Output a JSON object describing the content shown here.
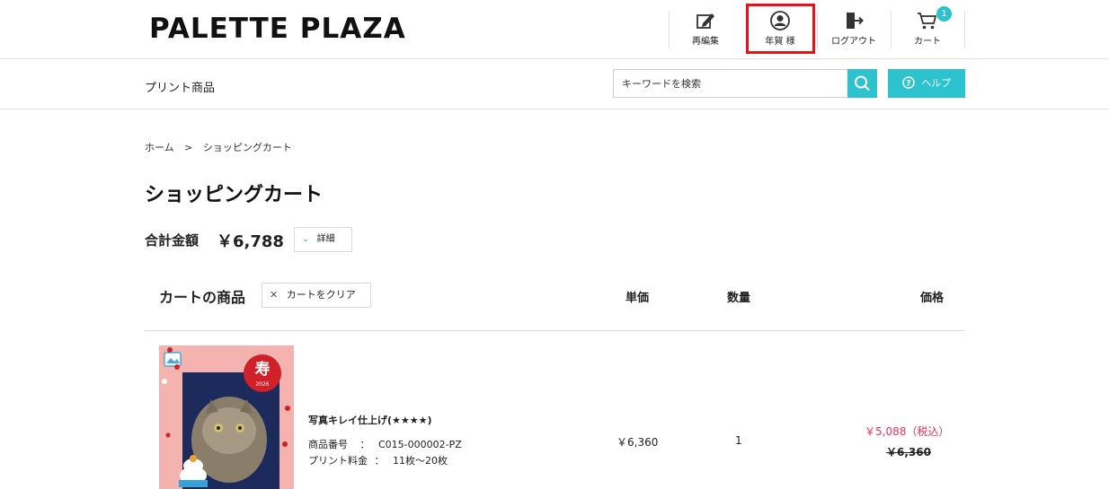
{
  "header": {
    "logo": "PALETTE PLAZA",
    "nav": {
      "reedit": "再編集",
      "user": "年賀 様",
      "logout": "ログアウト",
      "cart": "カート",
      "cart_count": "1"
    }
  },
  "subnav": {
    "category": "プリント商品",
    "search_placeholder": "キーワードを検索",
    "help": "ヘルプ"
  },
  "breadcrumb": {
    "home": "ホーム",
    "separator": ">",
    "current": "ショッピングカート"
  },
  "page": {
    "title": "ショッピングカート",
    "total_label": "合計金額",
    "total_value": "￥6,788",
    "detail_button": "詳細"
  },
  "cart": {
    "heading": "カートの商品",
    "clear_button": "カートをクリア",
    "columns": {
      "unit_price": "単価",
      "quantity": "数量",
      "price": "価格"
    },
    "items": [
      {
        "name": "写真キレイ仕上げ(★★★★)",
        "product_no_label": "商品番号",
        "product_no": "C015-000002-PZ",
        "print_fee_label": "プリント料金",
        "print_fee": "11枚〜20枚",
        "unit_price": "￥6,360",
        "quantity": "1",
        "sale_price": "￥5,088（税込）",
        "original_price": "￥6,360",
        "thumb_year": "2026",
        "thumb_kanji": "寿"
      }
    ]
  },
  "colors": {
    "accent": "#2cc3cf",
    "highlight_border": "#e0141b",
    "sale": "#e0345a"
  }
}
